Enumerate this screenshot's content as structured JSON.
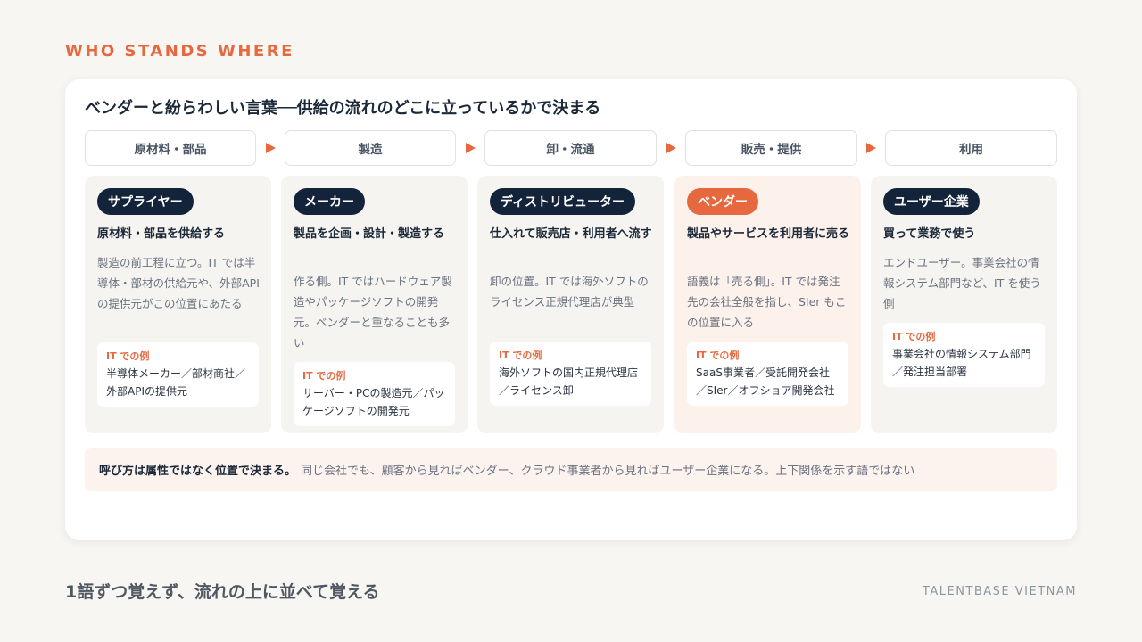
{
  "eyebrow": "WHO STANDS WHERE",
  "card": {
    "title": "ベンダーと紛らわしい言葉──供給の流れのどこに立っているかで決まる",
    "stages": [
      "原材料・部品",
      "製造",
      "卸・流通",
      "販売・提供",
      "利用"
    ]
  },
  "columns": [
    {
      "role": "サプライヤー",
      "subtitle": "原材料・部品を供給する",
      "description": "製造の前工程に立つ。IT では半導体・部材の供給元や、外部APIの提供元がこの位置にあたる",
      "example_label": "IT での例",
      "example_text": "半導体メーカー／部材商社／外部APIの提供元"
    },
    {
      "role": "メーカー",
      "subtitle": "製品を企画・設計・製造する",
      "description": "作る側。IT ではハードウェア製造やパッケージソフトの開発元。ベンダーと重なることも多い",
      "example_label": "IT での例",
      "example_text": "サーバー・PCの製造元／パッケージソフトの開発元"
    },
    {
      "role": "ディストリビューター",
      "subtitle": "仕入れて販売店・利用者へ流す",
      "description": "卸の位置。IT では海外ソフトのライセンス正規代理店が典型",
      "example_label": "IT での例",
      "example_text": "海外ソフトの国内正規代理店／ライセンス卸"
    },
    {
      "role": "ベンダー",
      "subtitle": "製品やサービスを利用者に売る",
      "description": "語義は「売る側」。IT では発注先の会社全般を指し、SIer もこの位置に入る",
      "example_label": "IT での例",
      "example_text": "SaaS事業者／受託開発会社／SIer／オフショア開発会社"
    },
    {
      "role": "ユーザー企業",
      "subtitle": "買って業務で使う",
      "description": "エンドユーザー。事業会社の情報システム部門など、IT を使う側",
      "example_label": "IT での例",
      "example_text": "事業会社の情報システム部門／発注担当部署"
    }
  ],
  "note": {
    "bold": "呼び方は属性ではなく位置で決まる。",
    "text": "同じ会社でも、顧客から見ればベンダー、クラウド事業者から見ればユーザー企業になる。上下関係を示す語ではない"
  },
  "footer": {
    "tagline": "1語ずつ覚えず、流れの上に並べて覚える",
    "brand": "TALENTBASE VIETNAM"
  },
  "colors": {
    "accent": "#e5683f",
    "navy": "#13233a",
    "highlight_bg": "#fdf1ec"
  }
}
